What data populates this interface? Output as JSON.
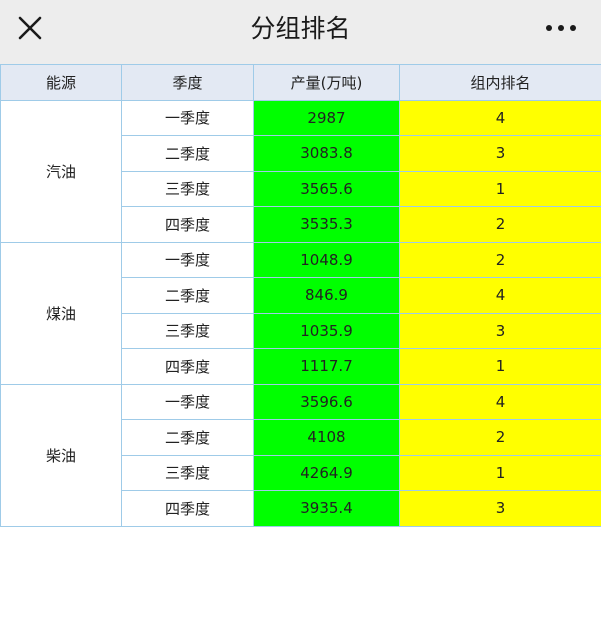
{
  "header": {
    "title": "分组排名",
    "close_icon": "close-icon",
    "more_icon": "more-icon"
  },
  "table": {
    "columns": [
      "能源",
      "季度",
      "产量(万吨)",
      "组内排名"
    ],
    "groups": [
      {
        "energy": "汽油",
        "rows": [
          {
            "quarter": "一季度",
            "output": "2987",
            "rank": "4"
          },
          {
            "quarter": "二季度",
            "output": "3083.8",
            "rank": "3"
          },
          {
            "quarter": "三季度",
            "output": "3565.6",
            "rank": "1"
          },
          {
            "quarter": "四季度",
            "output": "3535.3",
            "rank": "2"
          }
        ]
      },
      {
        "energy": "煤油",
        "rows": [
          {
            "quarter": "一季度",
            "output": "1048.9",
            "rank": "2"
          },
          {
            "quarter": "二季度",
            "output": "846.9",
            "rank": "4"
          },
          {
            "quarter": "三季度",
            "output": "1035.9",
            "rank": "3"
          },
          {
            "quarter": "四季度",
            "output": "1117.7",
            "rank": "1"
          }
        ]
      },
      {
        "energy": "柴油",
        "rows": [
          {
            "quarter": "一季度",
            "output": "3596.6",
            "rank": "4"
          },
          {
            "quarter": "二季度",
            "output": "4108",
            "rank": "2"
          },
          {
            "quarter": "三季度",
            "output": "4264.9",
            "rank": "1"
          },
          {
            "quarter": "四季度",
            "output": "3935.4",
            "rank": "3"
          }
        ]
      }
    ]
  },
  "colors": {
    "output_cell": "#00ff00",
    "rank_cell": "#ffff00",
    "header_row": "#e3e9f3",
    "border": "#9fcbe8",
    "topbar": "#ededed"
  }
}
